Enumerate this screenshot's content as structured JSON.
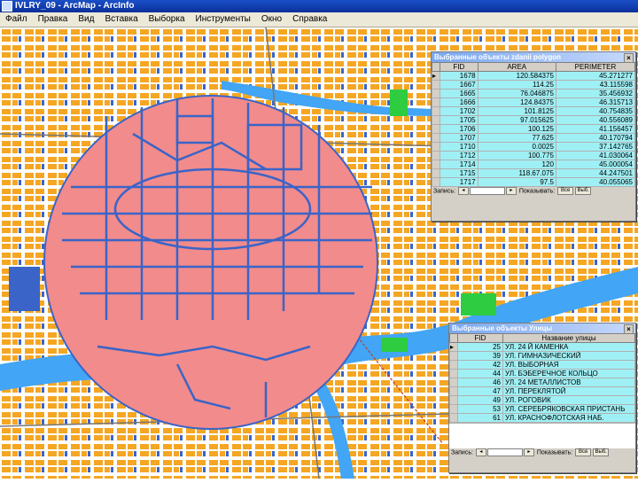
{
  "window": {
    "title": "IVLRY_09 - ArcMap - ArcInfo"
  },
  "menu": [
    "Файл",
    "Правка",
    "Вид",
    "Вставка",
    "Выборка",
    "Инструменты",
    "Окно",
    "Справка"
  ],
  "polygon_table": {
    "title": "Выбранные объекты zdanii polygon",
    "columns": [
      "FID",
      "AREA",
      "PERIMETER"
    ],
    "rows": [
      [
        "1678",
        "120.584375",
        "45.271277"
      ],
      [
        "1667",
        "114.25",
        "43.115598"
      ],
      [
        "1665",
        "76.046875",
        "35.456932"
      ],
      [
        "1666",
        "124.84375",
        "46.315713"
      ],
      [
        "1702",
        "101.8125",
        "40.754835"
      ],
      [
        "1705",
        "97.015625",
        "40.556089"
      ],
      [
        "1706",
        "100.125",
        "41.156457"
      ],
      [
        "1707",
        "77.625",
        "40.170794"
      ],
      [
        "1710",
        "0.0025",
        "37.142765"
      ],
      [
        "1712",
        "100.775",
        "41.030064"
      ],
      [
        "1714",
        "120",
        "45.000054"
      ],
      [
        "1715",
        "118.67.075",
        "44.247501"
      ],
      [
        "1717",
        "97.5",
        "40.055065"
      ]
    ],
    "status": {
      "label": "Запись:",
      "records_label": "Показывать:",
      "all": "Все",
      "sel": "Выб."
    }
  },
  "streets_table": {
    "title": "Выбранные объекты Улицы",
    "columns": [
      "FID",
      "Название улицы"
    ],
    "rows": [
      [
        "25",
        "УЛ. 24 Й КАМЕНКА"
      ],
      [
        "39",
        "УЛ. ГИМНАЗИЧЕСКИЙ"
      ],
      [
        "42",
        "УЛ. ВЫБОРНАЯ"
      ],
      [
        "44",
        "УЛ. БЭБЕРЕЧНОЕ КОЛЬЦО"
      ],
      [
        "46",
        "УЛ. 24 МЕТАЛЛИСТОВ"
      ],
      [
        "47",
        "УЛ. ПЕРЕКЛЯТОЙ"
      ],
      [
        "49",
        "УЛ. РОГОВИК"
      ],
      [
        "53",
        "УЛ. СЕРЕБРЯКОВСКАЯ ПРИСТАНЬ"
      ],
      [
        "61",
        "УЛ. КРАСНОФЛОТСКАЯ НАБ."
      ]
    ],
    "status": {
      "label": "Запись:",
      "records_label": "Показывать:",
      "all": "Все",
      "sel": "Выб."
    }
  }
}
